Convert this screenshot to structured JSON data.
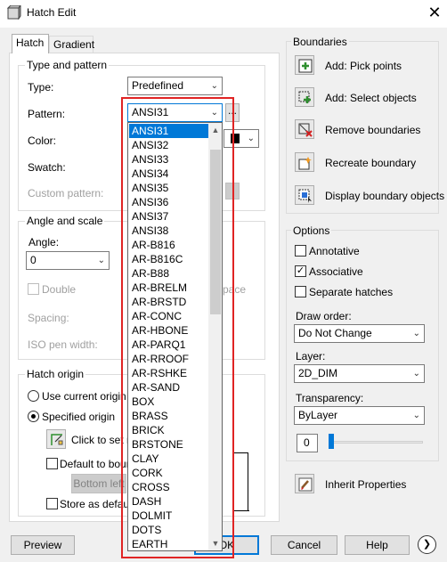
{
  "window": {
    "title": "Hatch Edit",
    "close_glyph": "✕"
  },
  "tabs": {
    "hatch": "Hatch",
    "gradient": "Gradient"
  },
  "type_and_pattern": {
    "group_title": "Type and pattern",
    "type_label": "Type:",
    "type_value": "Predefined",
    "pattern_label": "Pattern:",
    "pattern_value": "ANSI31",
    "pattern_browse": "...",
    "color_label": "Color:",
    "swatch_label": "Swatch:",
    "custom_pattern_label": "Custom pattern:"
  },
  "angle_and_scale": {
    "group_title": "Angle and scale",
    "angle_label": "Angle:",
    "angle_value": "0",
    "double_label": "Double",
    "space_label": "pace",
    "spacing_label": "Spacing:",
    "iso_pen_label": "ISO pen width:"
  },
  "hatch_origin": {
    "group_title": "Hatch origin",
    "use_current": "Use current origin",
    "specified": "Specified origin",
    "click_to_set": "Click to set n",
    "default_to_boundary": "Default to bound",
    "bottom_left": "Bottom left",
    "store_as_default": "Store as default"
  },
  "boundaries": {
    "group_title": "Boundaries",
    "add_pick_points": "Add: Pick points",
    "add_select_objects": "Add: Select objects",
    "remove_boundaries": "Remove boundaries",
    "recreate_boundary": "Recreate boundary",
    "display_boundary_objects": "Display boundary objects"
  },
  "options": {
    "group_title": "Options",
    "annotative": "Annotative",
    "associative": "Associative",
    "associative_checked": true,
    "separate_hatches": "Separate hatches",
    "draw_order_label": "Draw order:",
    "draw_order_value": "Do Not Change",
    "layer_label": "Layer:",
    "layer_value": "2D_DIM",
    "transparency_label": "Transparency:",
    "transparency_value": "ByLayer",
    "transparency_amount": "0"
  },
  "inherit_properties": "Inherit Properties",
  "footer": {
    "preview": "Preview",
    "ok": "OK",
    "cancel": "Cancel",
    "help": "Help",
    "more_glyph": "❯"
  },
  "pattern_list": [
    "ANSI31",
    "ANSI32",
    "ANSI33",
    "ANSI34",
    "ANSI35",
    "ANSI36",
    "ANSI37",
    "ANSI38",
    "AR-B816",
    "AR-B816C",
    "AR-B88",
    "AR-BRELM",
    "AR-BRSTD",
    "AR-CONC",
    "AR-HBONE",
    "AR-PARQ1",
    "AR-RROOF",
    "AR-RSHKE",
    "AR-SAND",
    "BOX",
    "BRASS",
    "BRICK",
    "BRSTONE",
    "CLAY",
    "CORK",
    "CROSS",
    "DASH",
    "DOLMIT",
    "DOTS",
    "EARTH"
  ],
  "pattern_list_selected_index": 0,
  "colors": {
    "accent": "#0078d7",
    "highlight_box": "#e02424"
  }
}
